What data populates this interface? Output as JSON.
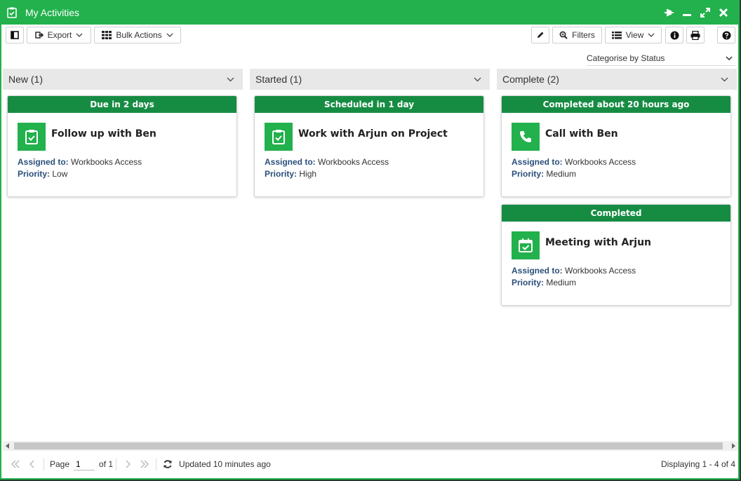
{
  "window": {
    "title": "My Activities",
    "accent": "#22b14c",
    "status_color": "#168c43"
  },
  "toolbar": {
    "export_label": "Export",
    "bulk_actions_label": "Bulk Actions",
    "filters_label": "Filters",
    "view_label": "View"
  },
  "categorise": {
    "label": "Categorise by Status"
  },
  "columns": [
    {
      "header": "New (1)",
      "cards": [
        {
          "status": "Due in 2 days",
          "icon": "clipboard-check-icon",
          "title": "Follow up with Ben",
          "assigned_label": "Assigned to:",
          "assigned": "Workbooks Access",
          "priority_label": "Priority:",
          "priority": "Low"
        }
      ]
    },
    {
      "header": "Started (1)",
      "cards": [
        {
          "status": "Scheduled in 1 day",
          "icon": "clipboard-check-icon",
          "title": "Work with Arjun on Project",
          "assigned_label": "Assigned to:",
          "assigned": "Workbooks Access",
          "priority_label": "Priority:",
          "priority": "High"
        }
      ]
    },
    {
      "header": "Complete (2)",
      "cards": [
        {
          "status": "Completed about 20 hours ago",
          "icon": "phone-icon",
          "title": "Call with Ben",
          "assigned_label": "Assigned to:",
          "assigned": "Workbooks Access",
          "priority_label": "Priority:",
          "priority": "Medium"
        },
        {
          "status": "Completed",
          "icon": "calendar-check-icon",
          "title": "Meeting with Arjun",
          "assigned_label": "Assigned to:",
          "assigned": "Workbooks Access",
          "priority_label": "Priority:",
          "priority": "Medium"
        }
      ]
    }
  ],
  "pager": {
    "page_label": "Page",
    "page_value": "1",
    "of_label": "of 1",
    "updated": "Updated 10 minutes ago",
    "displaying": "Displaying 1 - 4 of 4"
  }
}
